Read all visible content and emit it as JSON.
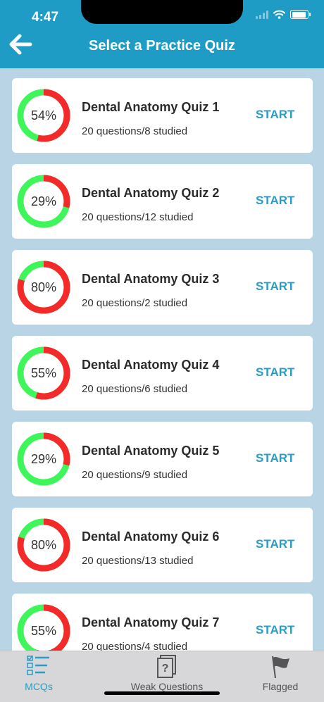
{
  "status": {
    "time": "4:47"
  },
  "header": {
    "title": "Select a Practice Quiz",
    "back_icon": "arrow-left-icon"
  },
  "colors": {
    "header": "#1f9cc6",
    "accent": "#2a9cc6",
    "progress_green": "#3ef55a",
    "progress_red": "#f42a2a",
    "background": "#b9d4e4"
  },
  "start_label": "START",
  "quizzes": [
    {
      "title": "Dental Anatomy Quiz 1",
      "subtitle": "20 questions/8 studied",
      "percent_label": "54%",
      "percent": 54
    },
    {
      "title": "Dental Anatomy Quiz 2",
      "subtitle": "20 questions/12 studied",
      "percent_label": "29%",
      "percent": 29
    },
    {
      "title": "Dental Anatomy Quiz 3",
      "subtitle": "20 questions/2 studied",
      "percent_label": "80%",
      "percent": 80
    },
    {
      "title": "Dental Anatomy Quiz 4",
      "subtitle": "20 questions/6 studied",
      "percent_label": "55%",
      "percent": 55
    },
    {
      "title": "Dental Anatomy Quiz 5",
      "subtitle": "20 questions/9 studied",
      "percent_label": "29%",
      "percent": 29
    },
    {
      "title": "Dental Anatomy Quiz 6",
      "subtitle": "20 questions/13 studied",
      "percent_label": "80%",
      "percent": 80
    },
    {
      "title": "Dental Anatomy Quiz 7",
      "subtitle": "20 questions/4 studied",
      "percent_label": "55%",
      "percent": 55
    }
  ],
  "tabs": [
    {
      "label": "MCQs",
      "icon": "checklist-icon",
      "active": true
    },
    {
      "label": "Weak Questions",
      "icon": "question-cards-icon",
      "active": false
    },
    {
      "label": "Flagged",
      "icon": "flag-icon",
      "active": false
    }
  ]
}
